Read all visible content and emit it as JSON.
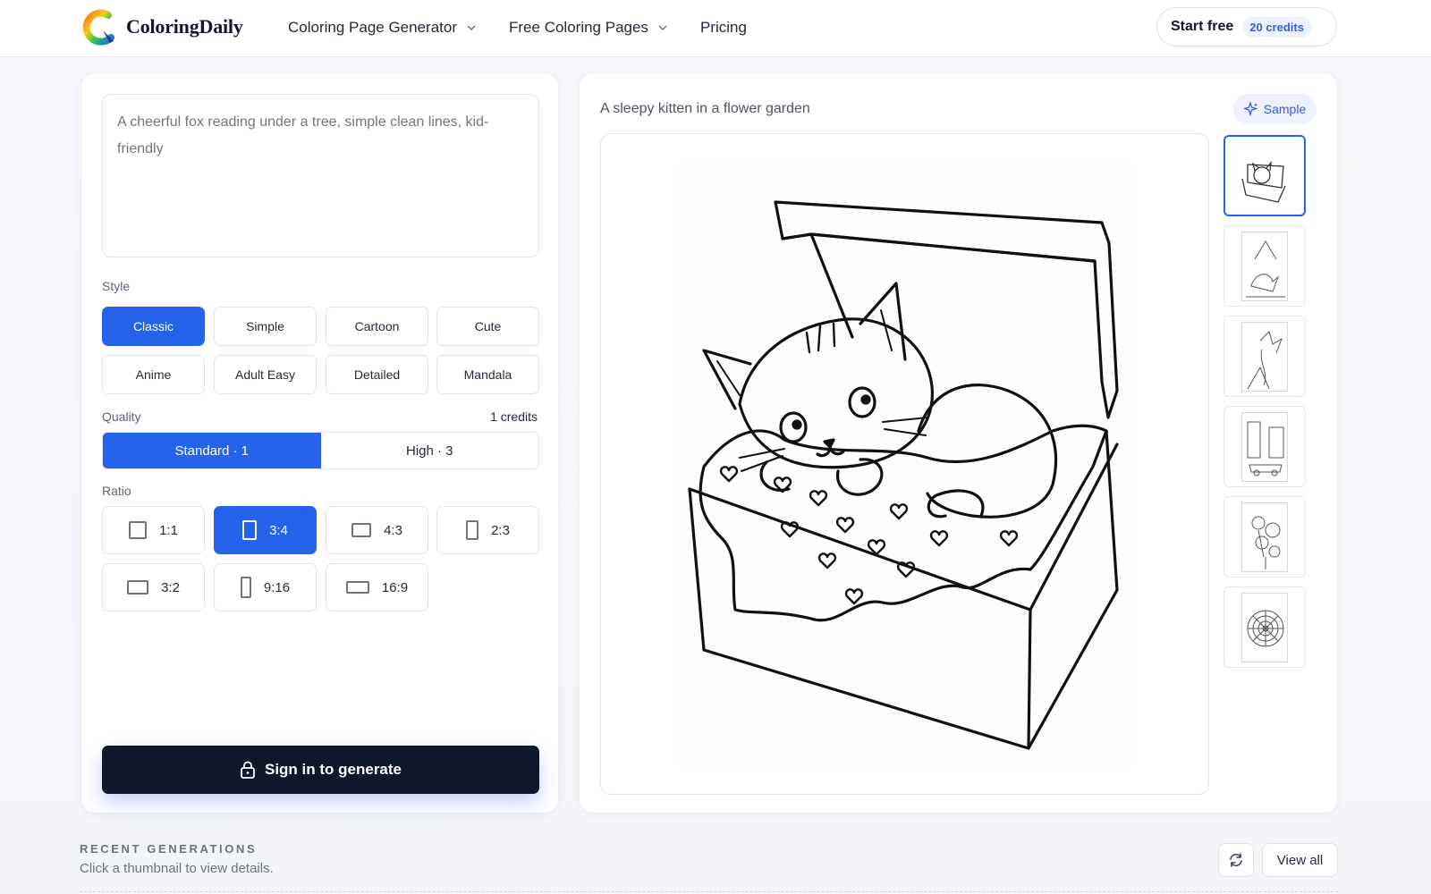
{
  "header": {
    "brand": "ColoringDaily",
    "nav": [
      {
        "label": "Coloring Page Generator",
        "has_dropdown": true
      },
      {
        "label": "Free Coloring Pages",
        "has_dropdown": true
      },
      {
        "label": "Pricing",
        "has_dropdown": false
      }
    ],
    "start_free_label": "Start free",
    "credits_badge": "20 credits"
  },
  "generator": {
    "prompt_placeholder": "A cheerful fox reading under a tree, simple clean lines, kid-friendly",
    "prompt_value": "",
    "style_label": "Style",
    "styles": [
      "Classic",
      "Simple",
      "Cartoon",
      "Cute",
      "Anime",
      "Adult Easy",
      "Detailed",
      "Mandala"
    ],
    "selected_style": "Classic",
    "quality_label": "Quality",
    "quality_cost": "1 credits",
    "quality_options": [
      "Standard · 1",
      "High · 3"
    ],
    "selected_quality": "Standard · 1",
    "ratio_label": "Ratio",
    "ratios": [
      "1:1",
      "3:4",
      "4:3",
      "2:3",
      "3:2",
      "9:16",
      "16:9"
    ],
    "selected_ratio": "3:4",
    "submit_label": "Sign in to generate"
  },
  "preview": {
    "sample_title": "A sleepy kitten in a flower garden",
    "sample_button": "Sample",
    "image_subject": "kitten-in-box-coloring-page",
    "thumbnails": [
      "kitten-in-box",
      "dinosaur-volcano",
      "dragon-castle",
      "city-street-car",
      "flower-bouquet",
      "mandala"
    ],
    "selected_thumbnail": 0
  },
  "recent": {
    "title": "RECENT GENERATIONS",
    "subtitle": "Click a thumbnail to view details.",
    "view_all": "View all"
  },
  "colors": {
    "accent": "#2563eb",
    "dark_button": "#0f172a",
    "badge_bg": "#eef2ff",
    "badge_text": "#3b5bdb"
  }
}
